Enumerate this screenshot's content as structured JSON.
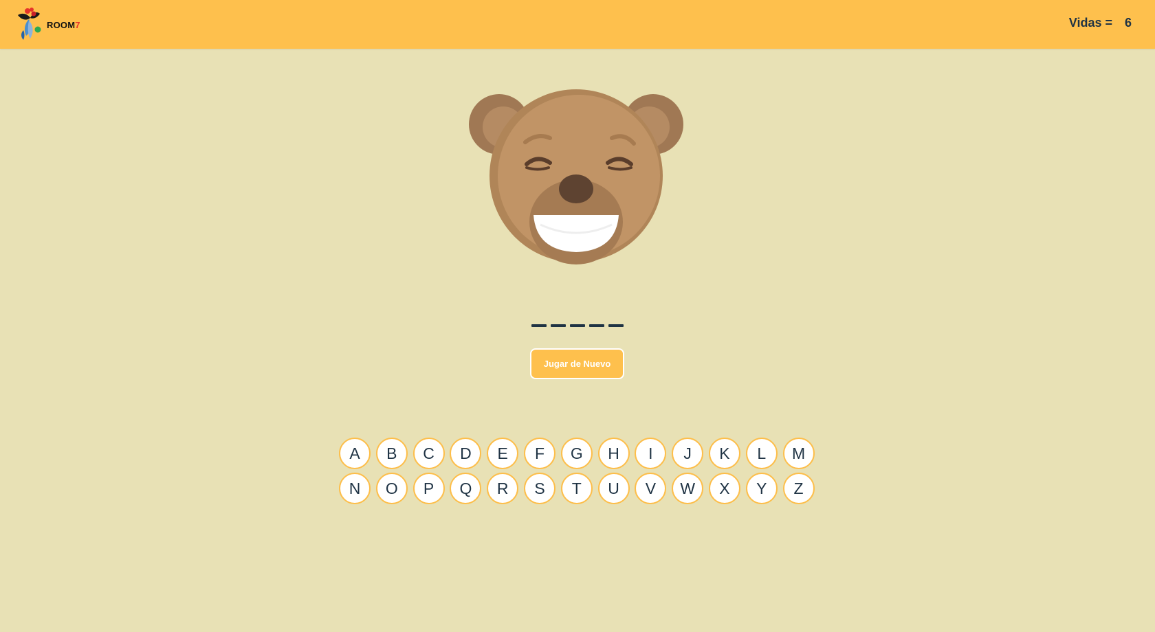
{
  "header": {
    "logo_text": "ROOM",
    "logo_number": "7",
    "lives_label": "Vidas =",
    "lives_value": "6"
  },
  "game": {
    "word_slots": 5,
    "replay_label": "Jugar de Nuevo",
    "bear_state": "laughing"
  },
  "keyboard": {
    "letters": [
      "A",
      "B",
      "C",
      "D",
      "E",
      "F",
      "G",
      "H",
      "I",
      "J",
      "K",
      "L",
      "M",
      "N",
      "O",
      "P",
      "Q",
      "R",
      "S",
      "T",
      "U",
      "V",
      "W",
      "X",
      "Y",
      "Z"
    ]
  },
  "colors": {
    "header": "#fec04d",
    "background": "#e8e1b5",
    "text": "#1f3344",
    "key_border": "#fdbe4a"
  }
}
